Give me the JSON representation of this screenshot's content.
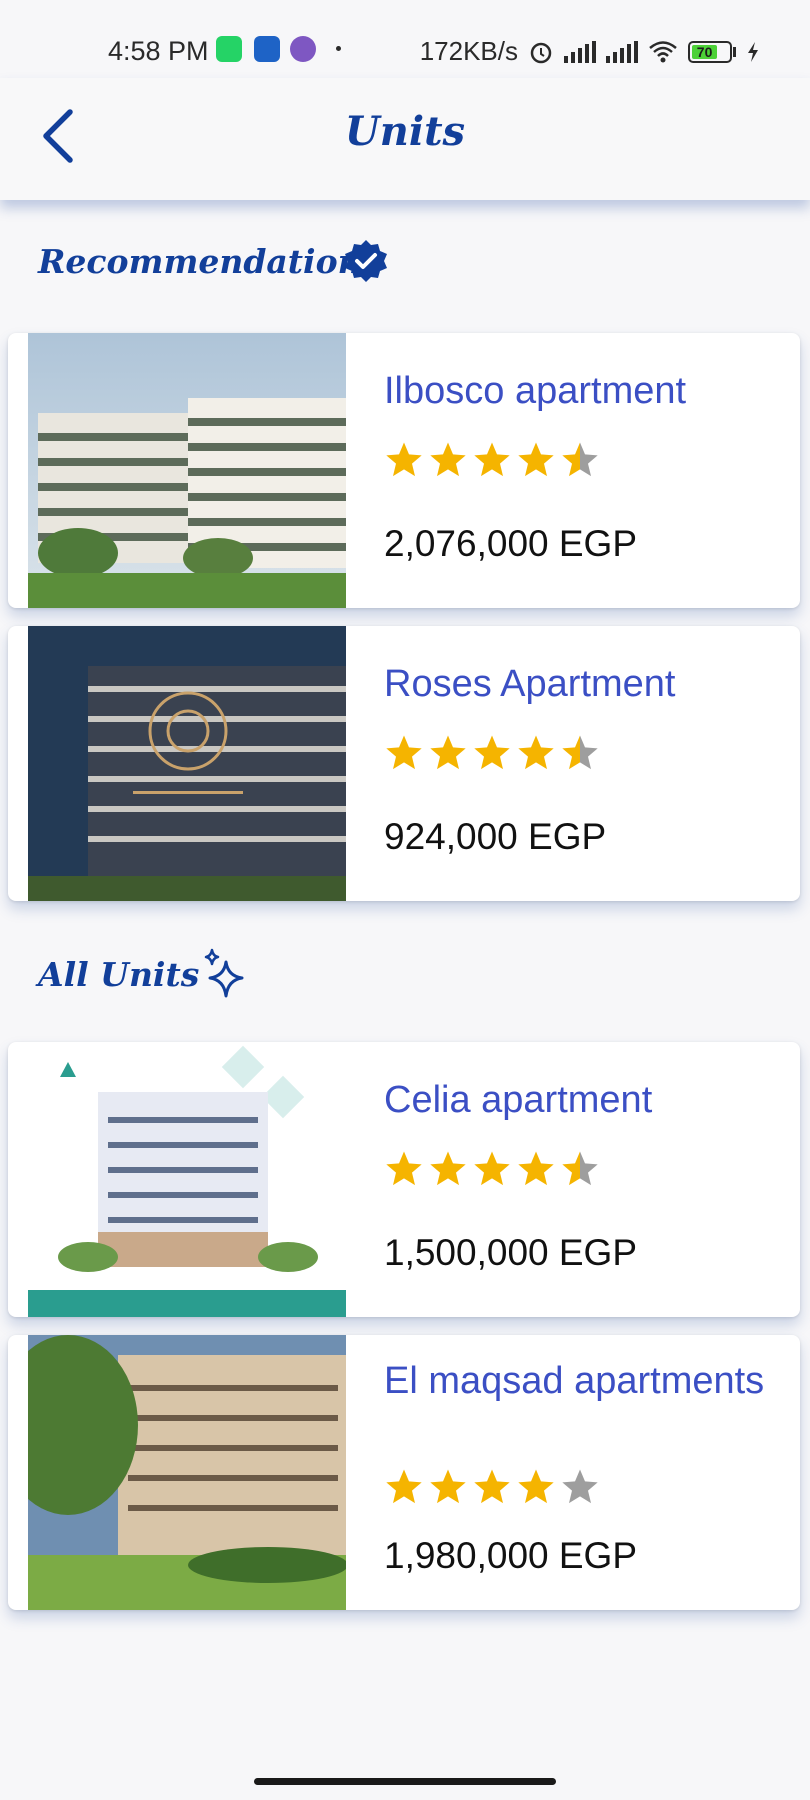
{
  "status_bar": {
    "time": "4:58 PM",
    "net_speed": "172KB/s",
    "battery": "70",
    "icons": [
      "whatsapp-icon",
      "app-notification-icon",
      "butterfly-icon",
      "alarm-icon",
      "signal-icon",
      "wifi-icon",
      "battery-icon",
      "charging-icon"
    ]
  },
  "header": {
    "title": "Units",
    "back_icon": "chevron-left-icon"
  },
  "recommendation": {
    "title": "Recommendation",
    "icon": "verified-badge-icon",
    "items": [
      {
        "name": "Ilbosco apartment",
        "rating": 4.5,
        "price": "2,076,000 EGP",
        "image": "modern-apartment-building-greenery"
      },
      {
        "name": "Roses Apartment",
        "rating": 4.5,
        "price": "924,000 EGP",
        "image": "roses-new-capital-building-night"
      }
    ]
  },
  "all_units": {
    "title": "All Units",
    "icon": "sparkles-icon",
    "items": [
      {
        "name": "Celia  apartment",
        "rating": 4.5,
        "price": "1,500,000 EGP",
        "image": "celia-white-tower"
      },
      {
        "name": "El maqsad apartments",
        "rating": 4,
        "price": "1,980,000 EGP",
        "image": "beige-apartment-garden"
      }
    ]
  },
  "colors": {
    "accent": "#123f9a",
    "unit_name": "#3b4fc4",
    "star_filled": "#f5b400",
    "star_empty": "#9e9e9e"
  }
}
